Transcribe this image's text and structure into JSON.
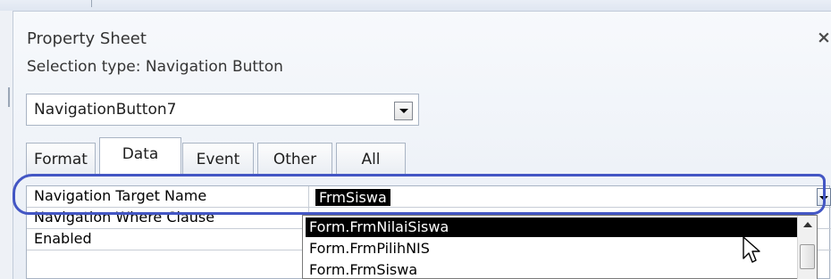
{
  "panel": {
    "title": "Property Sheet",
    "close_glyph": "×",
    "selection_type": "Selection type:  Navigation Button"
  },
  "selector": {
    "value": "NavigationButton7"
  },
  "tabs": [
    {
      "label": "Format",
      "active": false
    },
    {
      "label": "Data",
      "active": true
    },
    {
      "label": "Event",
      "active": false
    },
    {
      "label": "Other",
      "active": false
    },
    {
      "label": "All",
      "active": false
    }
  ],
  "properties": [
    {
      "label": "Navigation Target Name",
      "value": "FrmSiswa"
    },
    {
      "label": "Navigation Where Clause",
      "value": ""
    },
    {
      "label": "Enabled",
      "value": ""
    }
  ],
  "dropdown": {
    "options": [
      "Form.FrmNilaiSiswa",
      "Form.FrmPilihNIS",
      "Form.FrmSiswa"
    ],
    "highlighted_index": 0
  },
  "icons": {
    "close": "close-icon",
    "dropdown": "chevron-down-icon",
    "scroll_up": "scroll-up-icon",
    "cursor": "mouse-pointer-icon"
  },
  "colors": {
    "highlight_ring": "#4356c4",
    "selection": "#000000"
  }
}
